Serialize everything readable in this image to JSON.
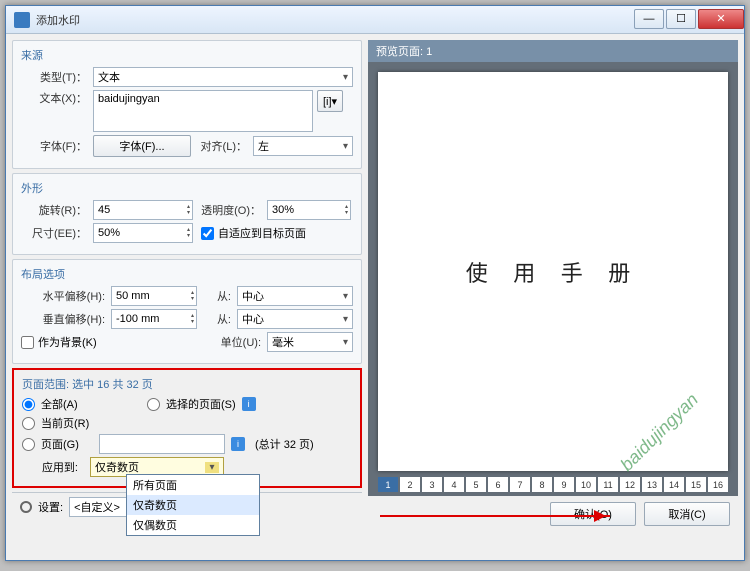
{
  "window": {
    "title": "添加水印"
  },
  "source": {
    "groupTitle": "来源",
    "typeLabel": "类型(T)：",
    "typeValue": "文本",
    "textLabel": "文本(X)：",
    "textValue": "baidujingyan",
    "fontLabel": "字体(F)：",
    "fontButton": "字体(F)...",
    "alignLabel": "对齐(L)：",
    "alignValue": "左"
  },
  "shape": {
    "groupTitle": "外形",
    "rotateLabel": "旋转(R)：",
    "rotateValue": "45",
    "opacityLabel": "透明度(O)：",
    "opacityValue": "30%",
    "scaleLabel": "尺寸(EE)：",
    "scaleValue": "50%",
    "fitLabel": "自适应到目标页面"
  },
  "layout": {
    "groupTitle": "布局选项",
    "hOffsetLabel": "水平偏移(H):",
    "hOffsetValue": "50 mm",
    "hFromLabel": "从:",
    "hFromValue": "中心",
    "vOffsetLabel": "垂直偏移(H):",
    "vOffsetValue": "-100 mm",
    "vFromLabel": "从:",
    "vFromValue": "中心",
    "bgLabel": "作为背景(K)",
    "unitLabel": "单位(U):",
    "unitValue": "毫米"
  },
  "range": {
    "title": "页面范围: 选中 16 共 32 页",
    "allLabel": "全部(A)",
    "selectedLabel": "选择的页面(S)",
    "currentLabel": "当前页(R)",
    "pagesLabel": "页面(G)",
    "pagesValue": "",
    "totalText": "(总计 32 页)",
    "applyLabel": "应用到:",
    "applyValue": "仅奇数页",
    "options": [
      "所有页面",
      "仅奇数页",
      "仅偶数页"
    ]
  },
  "settings": {
    "label": "设置:",
    "value": "<自定义>"
  },
  "preview": {
    "header": "预览页面: 1",
    "pageText": "使 用 手 册",
    "watermark": "baidujingyan",
    "thumbs": [
      "1",
      "2",
      "3",
      "4",
      "5",
      "6",
      "7",
      "8",
      "9",
      "10",
      "11",
      "12",
      "13",
      "14",
      "15",
      "16"
    ],
    "selected": "1"
  },
  "buttons": {
    "ok": "确认(O)",
    "cancel": "取消(C)"
  }
}
